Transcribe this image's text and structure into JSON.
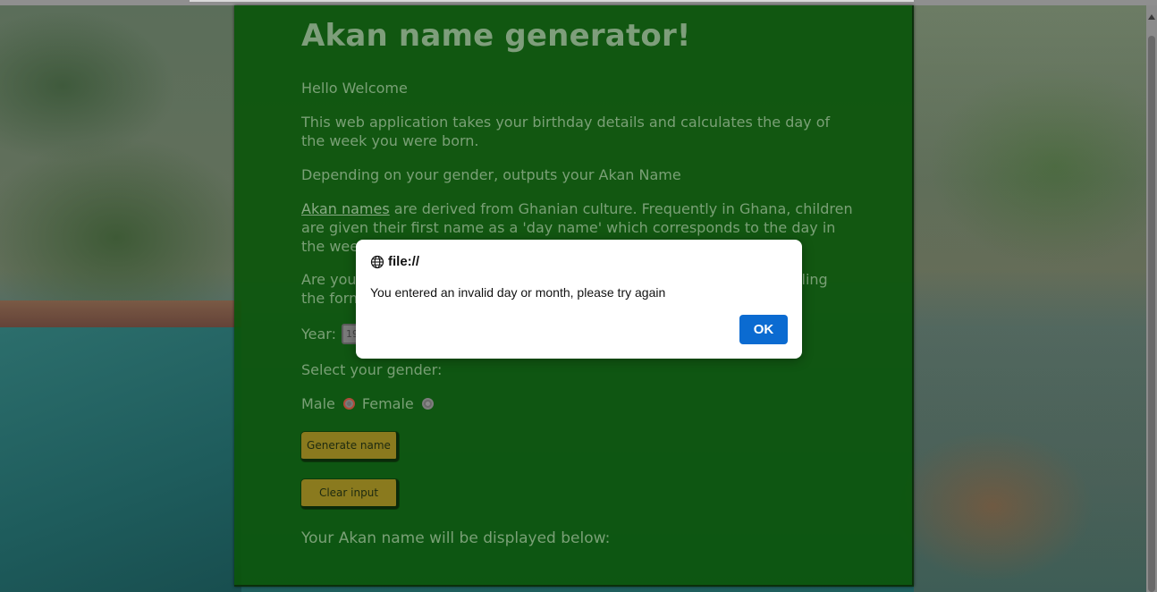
{
  "page": {
    "title": "Akan name generator!",
    "paragraphs": {
      "greeting": "Hello Welcome",
      "intro": "This web application takes your birthday details and calculates the day of the week you were born.",
      "gender_note": "Depending on your gender, outputs your Akan Name",
      "akan_link": "Akan names",
      "akan_desc": " are derived from Ghanian culture. Frequently in Ghana, children are given their first name as a 'day name' which corresponds to the day in the wee",
      "prompt_start": "Are you",
      "prompt_end": "ling",
      "prompt_line2": "the form"
    },
    "form": {
      "year_label": "Year:",
      "year_value": "19",
      "gender_label": "Select your gender:",
      "male_label": "Male",
      "female_label": "Female",
      "selected_gender": "Male",
      "generate_button": "Generate name",
      "clear_button": "Clear input"
    },
    "result_label": "Your Akan name will be displayed below:"
  },
  "dialog": {
    "origin": "file://",
    "message": "You entered an invalid day or month, please try again",
    "ok_label": "OK",
    "icon": "globe-icon"
  },
  "colors": {
    "panel": "#0c550c",
    "button": "#8a7a1e",
    "ok_button": "#0b6bd1"
  }
}
